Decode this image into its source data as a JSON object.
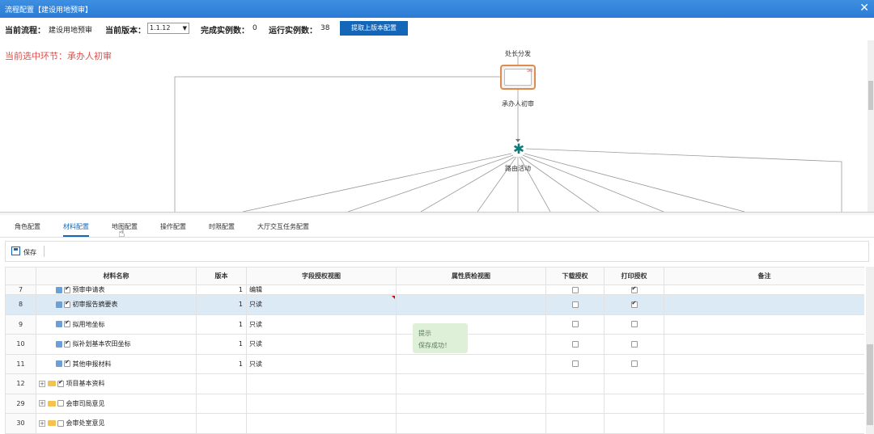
{
  "window": {
    "title": "流程配置【建设用地预审】",
    "close_icon": "close-icon"
  },
  "info": {
    "flow_label": "当前流程：",
    "flow_value": "建设用地预审",
    "version_label": "当前版本：",
    "version_value": "1.1.12",
    "done_label": "完成实例数：",
    "done_value": "0",
    "running_label": "运行实例数：",
    "running_value": "38",
    "fetch_button": "提取上版本配置"
  },
  "current_node": "当前选中环节：承办人初审",
  "diagram": {
    "top_label": "处长分发",
    "task_label": "承办人初审",
    "route_label": "路由活动"
  },
  "tabs": [
    {
      "label": "角色配置",
      "active": false
    },
    {
      "label": "材料配置",
      "active": true
    },
    {
      "label": "地图配置",
      "active": false
    },
    {
      "label": "操作配置",
      "active": false
    },
    {
      "label": "时限配置",
      "active": false
    },
    {
      "label": "大厅交互任务配置",
      "active": false
    }
  ],
  "toolbar": {
    "save_label": "保存"
  },
  "grid": {
    "headers": [
      "",
      "材料名称",
      "版本",
      "字段授权视图",
      "属性质检视图",
      "下载授权",
      "打印授权",
      "备注"
    ],
    "partial_row": {
      "num": "7",
      "name": "预审申请表",
      "version": "1",
      "field_view": "编辑"
    },
    "rows": [
      {
        "num": "8",
        "name": "初审报告摘要表",
        "version": "1",
        "field_view": "只读",
        "download": false,
        "print": true,
        "selected": true
      },
      {
        "num": "9",
        "name": "拟用地坐标",
        "version": "1",
        "field_view": "只读",
        "download": false,
        "print": false,
        "selected": false
      },
      {
        "num": "10",
        "name": "拟补划基本农田坐标",
        "version": "1",
        "field_view": "只读",
        "download": false,
        "print": false,
        "selected": false
      },
      {
        "num": "11",
        "name": "其他申报材料",
        "version": "1",
        "field_view": "只读",
        "download": false,
        "print": false,
        "selected": false
      }
    ],
    "folders": [
      {
        "num": "12",
        "name": "项目基本资料",
        "checked": true
      },
      {
        "num": "29",
        "name": "会审司局意见",
        "checked": false
      },
      {
        "num": "30",
        "name": "会审处室意见",
        "checked": false
      }
    ]
  },
  "toast": {
    "title": "提示",
    "message": "保存成功！"
  }
}
